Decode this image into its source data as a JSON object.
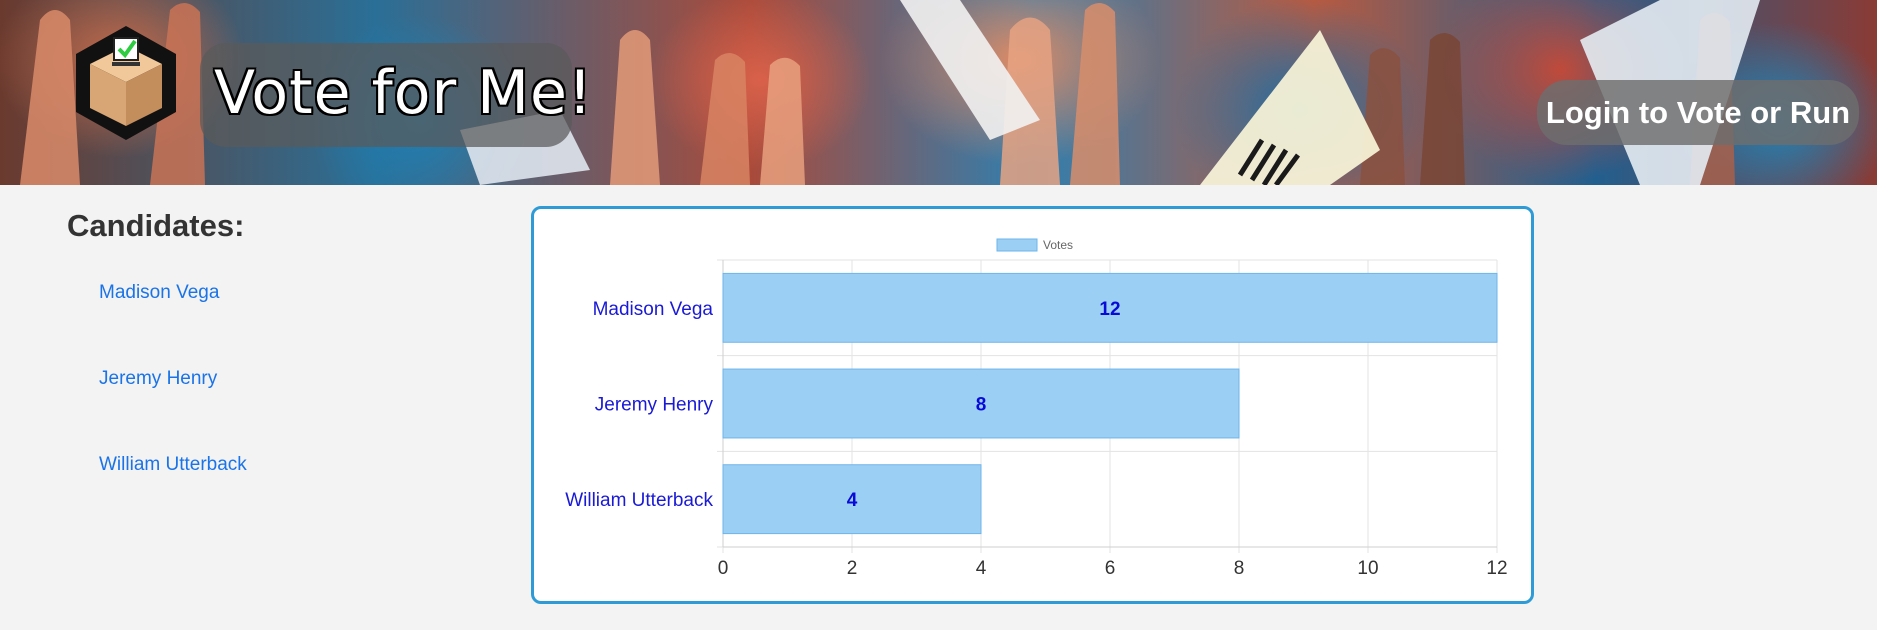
{
  "header": {
    "title": "Vote for Me!",
    "login_label": "Login to Vote or Run",
    "logo_icon": "ballot-box-icon"
  },
  "sidebar": {
    "heading": "Candidates:",
    "candidates": [
      "Madison Vega",
      "Jeremy Henry",
      "William Utterback"
    ]
  },
  "colors": {
    "bar_fill": "#9ccff4",
    "bar_border": "#6fb5ea",
    "value_label": "#0a0ad8",
    "category_label": "#1a1ad6",
    "card_border": "#2e9bd6",
    "link": "#1a73e8"
  },
  "chart_data": {
    "type": "bar",
    "orientation": "horizontal",
    "categories": [
      "Madison Vega",
      "Jeremy Henry",
      "William Utterback"
    ],
    "series": [
      {
        "name": "Votes",
        "values": [
          12,
          8,
          4
        ]
      }
    ],
    "xlim": [
      0,
      12
    ],
    "x_ticks": [
      "0",
      "2",
      "4",
      "6",
      "8",
      "10",
      "12"
    ],
    "legend": "top-center",
    "grid": true,
    "data_labels": true
  }
}
